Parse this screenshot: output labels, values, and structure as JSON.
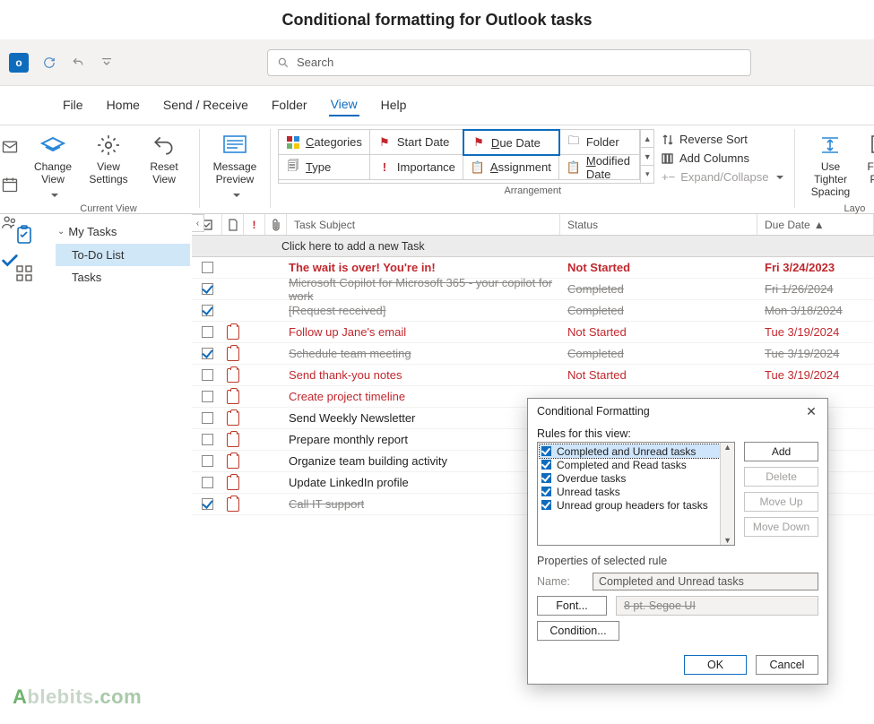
{
  "page_title": "Conditional formatting for Outlook tasks",
  "qat": {
    "search_placeholder": "Search"
  },
  "menubar": [
    "File",
    "Home",
    "Send / Receive",
    "Folder",
    "View",
    "Help"
  ],
  "menubar_active_index": 4,
  "ribbon": {
    "current_view_label": "Current View",
    "change_view": "Change\nView",
    "view_settings": "View\nSettings",
    "reset_view": "Reset\nView",
    "message_preview": "Message\nPreview",
    "arrangement_label": "Arrangement",
    "arrangement": {
      "categories": "Categories",
      "start_date": "Start Date",
      "due_date": "Due Date",
      "folder": "Folder",
      "type": "Type",
      "importance": "Importance",
      "assignment": "Assignment",
      "modified_date": "Modified Date"
    },
    "reverse_sort": "Reverse Sort",
    "add_columns": "Add Columns",
    "expand_collapse": "Expand/Collapse",
    "use_tighter": "Use Tighter\nSpacing",
    "folder_pane": "Folder\nPane",
    "layout_label": "Layo"
  },
  "nav": {
    "header": "My Tasks",
    "items": [
      "To-Do List",
      "Tasks"
    ],
    "selected_index": 0
  },
  "columns": {
    "subject": "Task Subject",
    "status": "Status",
    "due": "Due Date"
  },
  "new_task_hint": "Click here to add a new Task",
  "tasks": [
    {
      "checked": false,
      "hasClip": false,
      "subject": "The wait is over! You're in!",
      "status": "Not Started",
      "due": "Fri 3/24/2023",
      "style": "unread"
    },
    {
      "checked": true,
      "hasClip": false,
      "subject": "Microsoft Copilot for Microsoft 365 - your copilot for work",
      "status": "Completed",
      "due": "Fri 1/26/2024",
      "style": "completed"
    },
    {
      "checked": true,
      "hasClip": false,
      "subject": "[Request received]",
      "status": "Completed",
      "due": "Mon 3/18/2024",
      "style": "completed"
    },
    {
      "checked": false,
      "hasClip": true,
      "subject": "Follow up Jane's email",
      "status": "Not Started",
      "due": "Tue 3/19/2024",
      "style": "overdue"
    },
    {
      "checked": true,
      "hasClip": true,
      "subject": "Schedule team meeting",
      "status": "Completed",
      "due": "Tue 3/19/2024",
      "style": "completed"
    },
    {
      "checked": false,
      "hasClip": true,
      "subject": "Send thank-you notes",
      "status": "Not Started",
      "due": "Tue 3/19/2024",
      "style": "overdue"
    },
    {
      "checked": false,
      "hasClip": true,
      "subject": "Create project timeline",
      "status": "",
      "due": "",
      "style": "overdue"
    },
    {
      "checked": false,
      "hasClip": true,
      "subject": "Send Weekly Newsletter",
      "status": "",
      "due": "",
      "style": "normal"
    },
    {
      "checked": false,
      "hasClip": true,
      "subject": "Prepare monthly report",
      "status": "",
      "due": "",
      "style": "normal"
    },
    {
      "checked": false,
      "hasClip": true,
      "subject": "Organize team building activity",
      "status": "",
      "due": "",
      "style": "normal"
    },
    {
      "checked": false,
      "hasClip": true,
      "subject": "Update LinkedIn profile",
      "status": "",
      "due": "",
      "style": "normal"
    },
    {
      "checked": true,
      "hasClip": true,
      "subject": "Call IT support",
      "status": "",
      "due": "",
      "style": "completed"
    }
  ],
  "dialog": {
    "title": "Conditional Formatting",
    "rules_label": "Rules for this view:",
    "rules": [
      "Completed and Unread tasks",
      "Completed and Read tasks",
      "Overdue tasks",
      "Unread tasks",
      "Unread group headers for tasks"
    ],
    "selected_rule_index": 0,
    "add": "Add",
    "delete": "Delete",
    "move_up": "Move Up",
    "move_down": "Move Down",
    "props_label": "Properties of selected rule",
    "name_label": "Name:",
    "name_value": "Completed and Unread tasks",
    "font_btn": "Font...",
    "font_preview": "8 pt. Segoe UI",
    "condition_btn": "Condition...",
    "ok": "OK",
    "cancel": "Cancel"
  },
  "watermark": "Ablebits.com"
}
